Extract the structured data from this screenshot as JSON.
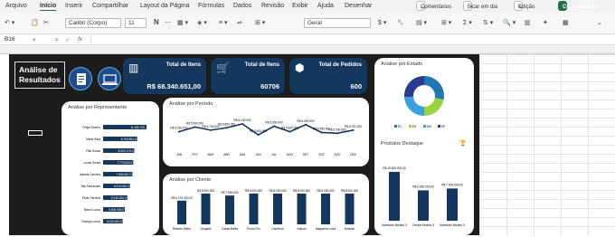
{
  "menu": {
    "tabs": [
      "Arquivo",
      "Início",
      "Inserir",
      "Compartilhar",
      "Layout da Página",
      "Fórmulas",
      "Dados",
      "Revisão",
      "Exibir",
      "Ajuda",
      "Desenhar"
    ],
    "comments": "Comentários",
    "catchup": "Ficar em dia",
    "editing": "Edição",
    "share": "Compartilhar"
  },
  "ribbon": {
    "font": "Calibri (Corpo)",
    "size": "11",
    "bold": "N",
    "format": "Geral"
  },
  "formula_bar": {
    "cell": "B16",
    "fx": "fx"
  },
  "dashboard": {
    "title_line1": "Análise de",
    "title_line2": "Resultados",
    "kpis": [
      {
        "label": "Total de Itens",
        "value": "R$ 68.340.651,00"
      },
      {
        "label": "Total de Itens",
        "value": "60706"
      },
      {
        "label": "Total de Pedidos",
        "value": "600"
      }
    ],
    "rep_title": "Análise por Representante",
    "period_title": "Análise por Período",
    "client_title": "Análise por Cliente",
    "state_title": "Análise por Estado",
    "products_title": "Produtos Destaque"
  },
  "chart_data": [
    {
      "type": "bar",
      "title": "Análise por Representante",
      "categories": [
        "Felipe Severo",
        "Maria Silva",
        "Rita Souza",
        "Lucas Souza",
        "Isabela Carolina",
        "Tais Fernandes",
        "Paulo Ferreira",
        "Marco Lucca",
        "Rodrigo Lucca"
      ],
      "values": [
        11180000,
        8760000,
        8020000,
        7770000,
        7550000,
        6910000,
        6230000,
        5600000,
        5030000
      ],
      "labels": [
        "11.180.700,",
        "8.760.800,0",
        "8.020.170,0",
        "7.770.000,0",
        "7.550.467,0",
        "6.910.000,0",
        "6.230.000,0",
        "5.600.000,0",
        "5.030.000,0"
      ]
    },
    {
      "type": "line",
      "title": "Análise por Período",
      "categories": [
        "JAN",
        "FEV",
        "MAR",
        "ABR",
        "MAI",
        "JUN",
        "JUL",
        "AGO",
        "SET",
        "OUT",
        "NOV",
        "DEZ"
      ],
      "values": [
        5600000,
        5900000,
        5700000,
        5850000,
        6100000,
        5400000,
        5950000,
        5600000,
        6050000,
        5550000,
        5500000,
        5700000
      ],
      "labels": [
        "R$ 5.600.000",
        "R$ 5.900.000",
        "R$ 5.700.000",
        "R$ 5.850.000",
        "R$ 6.100.000",
        "R$ 5.400.000",
        "R$ 5.950.000",
        "R$ 5.600.000",
        "R$ 6.050.000",
        "R$ 5.550.000",
        "R$ 5.500.000",
        "R$ 5.700.000"
      ]
    },
    {
      "type": "bar",
      "title": "Análise por Cliente",
      "categories": [
        "Ricardo Eletro",
        "Drogasil",
        "Casas Bahia",
        "Ponto Frio",
        "Carrefour",
        "Kabum",
        "Magazine Luiza",
        "Amazon"
      ],
      "values": [
        6170000,
        8000000,
        7500000,
        8000000,
        8000000,
        8000000,
        8000000,
        8000000
      ],
      "labels": [
        "R$ 6.170.000,00",
        "R$ 8.000.000",
        "R$ 7.500.000",
        "R$ 8.000.000",
        "R$ 8.000.000",
        "R$ 8.000.000",
        "R$ 8.000.000",
        "R$ 8.000.000"
      ]
    },
    {
      "type": "pie",
      "title": "Análise por Estado",
      "categories": [
        "RJ",
        "ES",
        "MG",
        "SP"
      ],
      "values": [
        28,
        22,
        24,
        26
      ],
      "colors": [
        "#1f77b4",
        "#9ad43c",
        "#3aa0e0",
        "#2b3c90"
      ]
    },
    {
      "type": "bar",
      "title": "Produtos Destaque",
      "categories": [
        "Notebook Modelo 3",
        "Celular Modelo 3",
        "Notebook Modelo 3"
      ],
      "values": [
        10600000,
        6600000,
        7000000
      ],
      "labels": [
        "R$ 10.600.000,00",
        "R$ 6.630.000,00",
        "R$ 7.000.000,00"
      ]
    }
  ]
}
